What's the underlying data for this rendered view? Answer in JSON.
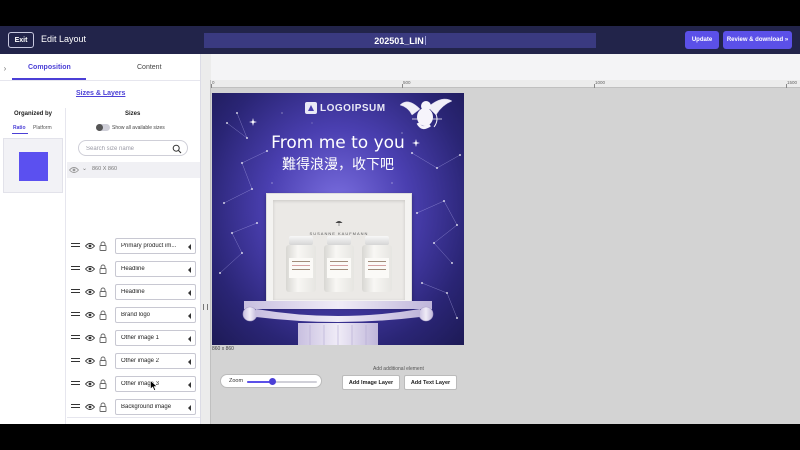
{
  "topbar": {
    "exit_label": "Exit",
    "title": "Edit Layout",
    "filename": "202501_LIN",
    "update_label": "Update",
    "review_label": "Review & download »"
  },
  "panel": {
    "tabs": [
      {
        "label": "Composition",
        "active": true
      },
      {
        "label": "Content",
        "active": false
      }
    ],
    "sizes_layers_link": "Sizes & Layers",
    "organized_by": {
      "label": "Organized by",
      "options": [
        "Ratio",
        "Platform"
      ],
      "selected": "Ratio"
    },
    "sizes": {
      "label": "Sizes",
      "toggle_label": "Show all available sizes",
      "search_placeholder": "Search size name",
      "group_label": "860 X 860"
    },
    "layers": [
      {
        "name": "Primary product im..."
      },
      {
        "name": "Headline"
      },
      {
        "name": "Headline"
      },
      {
        "name": "Brand logo"
      },
      {
        "name": "Other image 1"
      },
      {
        "name": "Other image 2"
      },
      {
        "name": "Other image 3"
      },
      {
        "name": "Background image"
      }
    ]
  },
  "canvas": {
    "ruler_ticks": [
      "0",
      "500",
      "1000",
      "1500"
    ],
    "artboard": {
      "logo_text": "LOGOIPSUM",
      "headline_1": "From me to you",
      "headline_2": "難得浪漫，收下吧",
      "brand_name": "SUSANNE KAUFMANN",
      "caption": "860 x 860"
    },
    "add_element": {
      "label": "Add additional element",
      "image_button": "Add Image Layer",
      "text_button": "Add Text Layer"
    },
    "zoom": {
      "label": "Zoom",
      "level": 0.35
    }
  },
  "colors": {
    "topbar": "#22244a",
    "accent": "#5b50e8",
    "canvas_bg": "#d3d3d3"
  }
}
